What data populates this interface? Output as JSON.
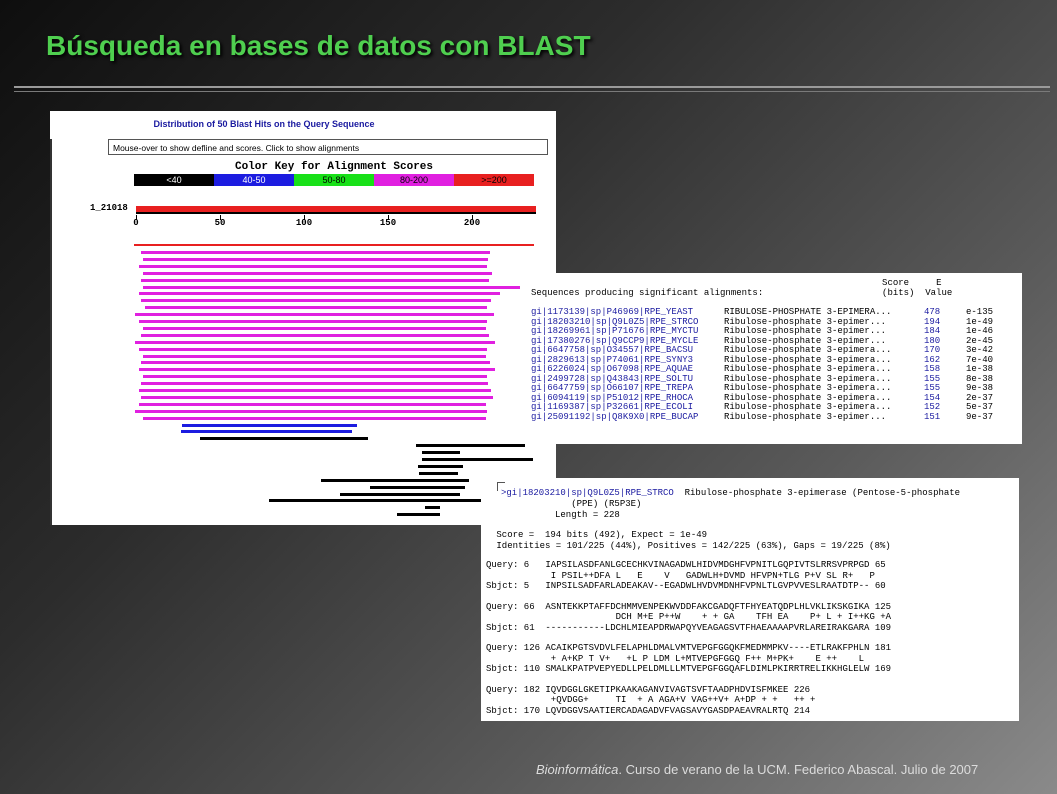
{
  "slide": {
    "title": "Búsqueda en bases de datos con BLAST",
    "footer_italic": "Bioinformática",
    "footer_rest": ". Curso de verano de la UCM. Federico Abascal. Julio de 2007"
  },
  "graphic": {
    "title": "Distribution of 50 Blast Hits on the Query Sequence",
    "mouseover_text": "Mouse-over to show defline and scores. Click to show alignments",
    "color_key_title": "Color Key for Alignment Scores",
    "color_key": [
      {
        "label": "<40",
        "bg": "#000000",
        "fg": "#ffffff"
      },
      {
        "label": "40-50",
        "bg": "#1c1ce0",
        "fg": "#ffffff"
      },
      {
        "label": "50-80",
        "bg": "#18e018",
        "fg": "#000000"
      },
      {
        "label": "80-200",
        "bg": "#e020e0",
        "fg": "#000000"
      },
      {
        "label": ">=200",
        "bg": "#e82020",
        "fg": "#000000"
      }
    ],
    "query_label": "1_21018",
    "axis_ticks": [
      "0",
      "50",
      "100",
      "150",
      "200"
    ]
  },
  "summary": {
    "header_line1": "                                                                 Score     E",
    "header_line2": "Sequences producing significant alignments:                      (bits)  Value",
    "rows": [
      {
        "id": "gi|1173139|sp|P46969|RPE_YEAST",
        "desc": "RIBULOSE-PHOSPHATE 3-EPIMERA...",
        "score": "478",
        "evalue": "e-135"
      },
      {
        "id": "gi|18203210|sp|Q9L0Z5|RPE_STRCO",
        "desc": "Ribulose-phosphate 3-epimer...",
        "score": "194",
        "evalue": "1e-49"
      },
      {
        "id": "gi|18269961|sp|P71676|RPE_MYCTU",
        "desc": "Ribulose-phosphate 3-epimer...",
        "score": "184",
        "evalue": "1e-46"
      },
      {
        "id": "gi|17380276|sp|Q9CCP9|RPE_MYCLE",
        "desc": "Ribulose-phosphate 3-epimer...",
        "score": "180",
        "evalue": "2e-45"
      },
      {
        "id": "gi|6647758|sp|O34557|RPE_BACSU",
        "desc": "Ribulose-phosphate 3-epimera...",
        "score": "170",
        "evalue": "3e-42"
      },
      {
        "id": "gi|2829613|sp|P74061|RPE_SYNY3",
        "desc": "Ribulose-phosphate 3-epimera...",
        "score": "162",
        "evalue": "7e-40"
      },
      {
        "id": "gi|6226024|sp|O67098|RPE_AQUAE",
        "desc": "Ribulose-phosphate 3-epimera...",
        "score": "158",
        "evalue": "1e-38"
      },
      {
        "id": "gi|2499728|sp|Q43843|RPE_SOLTU",
        "desc": "Ribulose-phosphate 3-epimera...",
        "score": "155",
        "evalue": "8e-38"
      },
      {
        "id": "gi|6647759|sp|O66107|RPE_TREPA",
        "desc": "Ribulose-phosphate 3-epimera...",
        "score": "155",
        "evalue": "9e-38"
      },
      {
        "id": "gi|6094119|sp|P51012|RPE_RHOCA",
        "desc": "Ribulose-phosphate 3-epimera...",
        "score": "154",
        "evalue": "2e-37"
      },
      {
        "id": "gi|1169387|sp|P32661|RPE_ECOLI",
        "desc": "Ribulose-phosphate 3-epimera...",
        "score": "152",
        "evalue": "5e-37"
      },
      {
        "id": "gi|25091192|sp|Q8K9X0|RPE_BUCAP",
        "desc": "Ribulose-phosphate 3-epimer...",
        "score": "151",
        "evalue": "9e-37"
      }
    ]
  },
  "alignment": {
    "defline_id": ">gi|18203210|sp|Q9L0Z5|RPE_STRCO",
    "defline_desc": "  Ribulose-phosphate 3-epimerase (Pentose-5-phosphate",
    "defline_line2": "             (PPE) (R5P3E)",
    "length": "          Length = 228",
    "score_line": " Score =  194 bits (492), Expect = 1e-49",
    "identities_line": " Identities = 101/225 (44%), Positives = 142/225 (63%), Gaps = 19/225 (8%)",
    "blocks": [
      {
        "query": "Query: 6   IAPSILASDFANLGCECHKVINAGADWLHIDVMDGHFVPNITLGQPIVTSLRRSVPRPGD 65",
        "match": "            I PSIL++DFA L   E    V   GADWLH+DVMD HFVPN+TLG P+V SL R+   P",
        "sbjct": "Sbjct: 5   INPSILSADFARLADEAKAV--EGADWLHVDVMDNHFVPNLTLGVPVVESLRAATDTP-- 60"
      },
      {
        "query": "Query: 66  ASNTEKKPTAFFDCHMMVENPEKWVDDFAKCGADQFTFHYEATQDPLHLVKLIKSKGIKA 125",
        "match": "                        DCH M+E P++W    + + GA    TFH EA    P+ L + I++KG +A",
        "sbjct": "Sbjct: 61  -----------LDCHLMIEAPDRWAPQYVEAGAGSVTFHAEAAAAPVRLAREIRAKGARA 109"
      },
      {
        "query": "Query: 126 ACAIKPGTSVDVLFELAPHLDMALVMTVEPGFGGQKFMEDMMPKV----ETLRAKFPHLN 181",
        "match": "            + A+KP T V+   +L P LDM L+MTVEPGFGGQ F++ M+PK+    E ++    L",
        "sbjct": "Sbjct: 110 SMALKPATPVEPYEDLLPELDMLLLMTVEPGFGGQAFLDIMLPKIRRTRELIKKHGLELW 169"
      },
      {
        "query": "Query: 182 IQVDGGLGKETIPKAAKAGANVIVAGTSVFTAADPHDVISFMKEE 226",
        "match": "            +QVDGG+     TI  + A AGA+V VAG++V+ A+DP + +   ++ +",
        "sbjct": "Sbjct: 170 LQVDGGVSAATIERCADAGADVFVAGSAVYGASDPAEAVRALRTQ 214"
      }
    ]
  }
}
